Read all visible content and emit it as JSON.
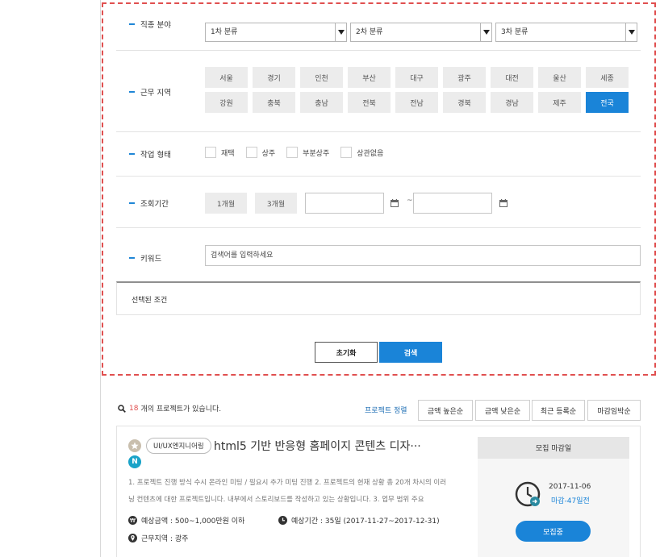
{
  "filters": {
    "job_field": {
      "label": "직종 분야",
      "select1": "1차 분류",
      "select2": "2차 분류",
      "select3": "3차 분류"
    },
    "region": {
      "label": "근무 지역",
      "items": [
        "서울",
        "경기",
        "인천",
        "부산",
        "대구",
        "광주",
        "대전",
        "울산",
        "세종",
        "강원",
        "충북",
        "충남",
        "전북",
        "전남",
        "경북",
        "경남",
        "제주",
        "전국"
      ],
      "active": "전국"
    },
    "work_type": {
      "label": "작업 형태",
      "options": [
        "재택",
        "상주",
        "부분상주",
        "상관없음"
      ]
    },
    "period": {
      "label": "조회기간",
      "btn1": "1개월",
      "btn2": "3개월",
      "separator": "~"
    },
    "keyword": {
      "label": "키워드",
      "placeholder": "검색어를 입력하세요"
    },
    "selected_label": "선택된 조건",
    "reset_label": "초기화",
    "search_label": "검색"
  },
  "results": {
    "count": "18",
    "suffix": "개의 프로젝트가 있습니다.",
    "sort_label": "프로젝트 정렬",
    "sort_options": [
      "금액 높은순",
      "금액 낮은순",
      "최근 등록순",
      "마감임박순"
    ]
  },
  "project": {
    "badge_n": "N",
    "category": "UI/UX엔지니어링",
    "title": "html5 기반 반응형 홈페이지 콘텐츠 디자···",
    "desc": "1. 프로젝트 진행 방식 수시 온라인 미팅 / 필요시 추가 미팅 진행 2. 프로젝트의 현재 상황 총 20개 차시의 이러닝 컨텐츠에 대한 프로젝트입니다. 내부에서 스토리보드를 작성하고 있는 상황입니다. 3. 업무 범위 주요",
    "budget": "예상금액 : 500~1,000만원 이하",
    "duration": "예상기간 : 35일 (2017-11-27~2017-12-31)",
    "location": "근무지역 : 광주",
    "deadline_head": "모집 마감일",
    "deadline_date": "2017-11-06",
    "deadline_left": "마감-47일전",
    "recruit_label": "모집중"
  },
  "colors": {
    "accent": "#1a84d8",
    "dashed_border": "#e05050",
    "count": "#e05050"
  }
}
